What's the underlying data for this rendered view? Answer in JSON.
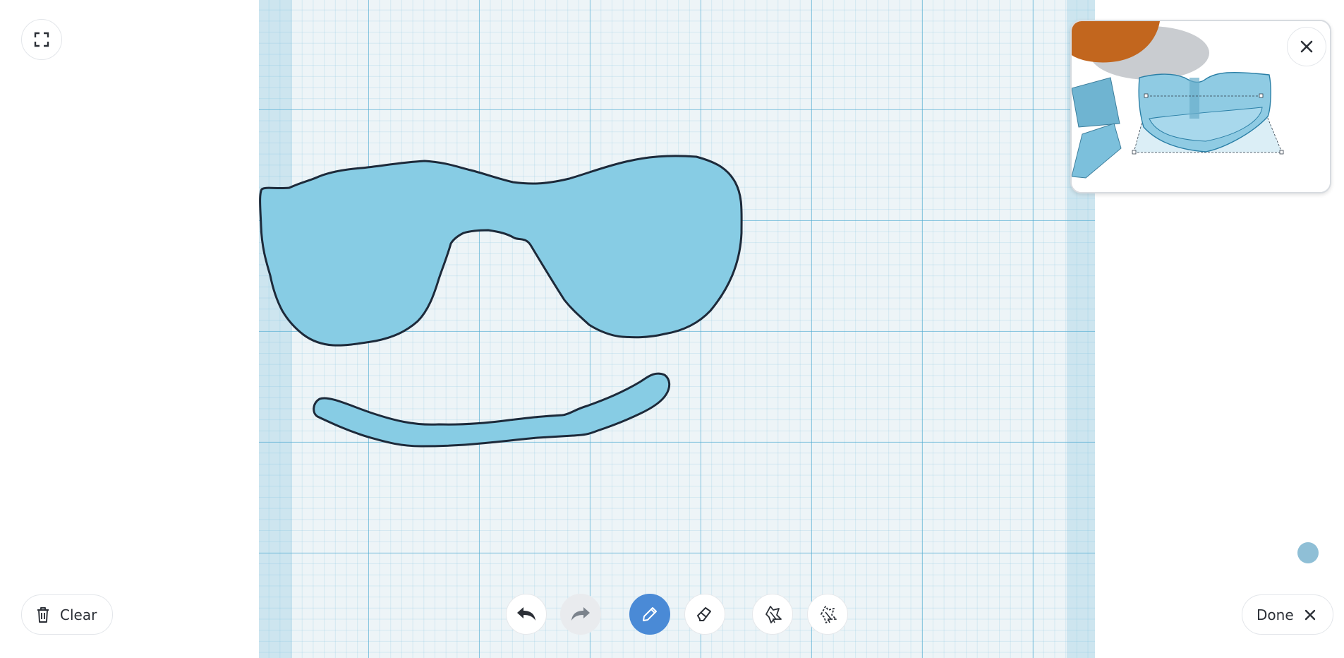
{
  "toolbar": {
    "clear_label": "Clear",
    "done_label": "Done"
  },
  "tools": [
    {
      "name": "undo",
      "icon": "undo-icon",
      "state": "enabled"
    },
    {
      "name": "redo",
      "icon": "redo-icon",
      "state": "disabled"
    },
    {
      "name": "draw",
      "icon": "pencil-icon",
      "state": "active"
    },
    {
      "name": "erase",
      "icon": "eraser-icon",
      "state": "enabled"
    },
    {
      "name": "select",
      "icon": "select-shape-icon",
      "state": "enabled"
    },
    {
      "name": "deselect",
      "icon": "deselect-shape-icon",
      "state": "enabled"
    }
  ],
  "colors": {
    "shape_fill": "#87cce4",
    "shape_stroke": "#1d2a3a",
    "active_tool": "#4a8ad6",
    "grid_major": "#49a8cf",
    "canvas_bg": "#edf4f7"
  },
  "icons": {
    "fullscreen": "fullscreen-icon",
    "trash": "trash-icon",
    "close": "close-icon",
    "color_swatch": "color-dot"
  }
}
